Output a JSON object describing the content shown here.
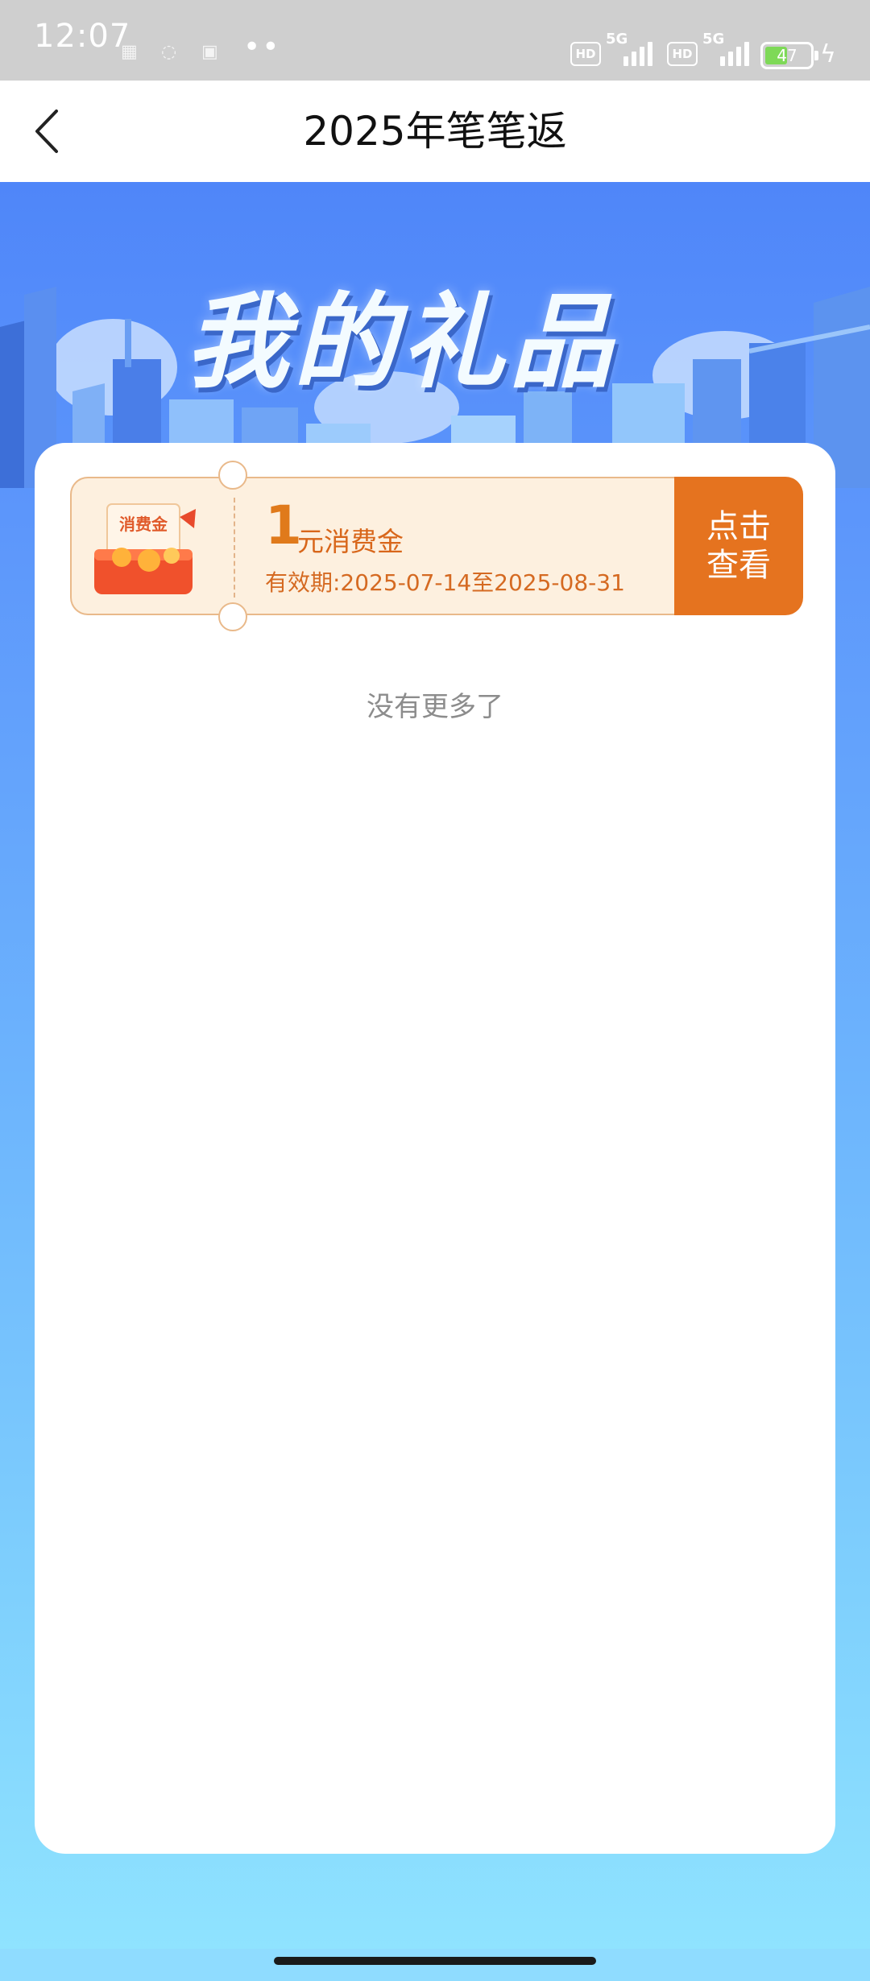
{
  "status_bar": {
    "time": "12:07",
    "battery_level": "47",
    "hd1": "HD",
    "hd2": "HD",
    "network1": "5G",
    "network2": "5G"
  },
  "nav": {
    "title": "2025年笔笔返",
    "back_icon": "chevron-left-icon"
  },
  "hero": {
    "title": "我的礼品"
  },
  "coupon": {
    "amount": "1",
    "unit_label": "元消费金",
    "validity": "有效期:2025-07-14至2025-08-31",
    "gift_label": "消费金",
    "button_line1": "点击",
    "button_line2": "查看"
  },
  "list": {
    "end_text": "没有更多了"
  },
  "colors": {
    "accent_orange": "#e5731f",
    "coupon_bg": "#fdf0df",
    "hero_blue": "#4f86f9"
  }
}
